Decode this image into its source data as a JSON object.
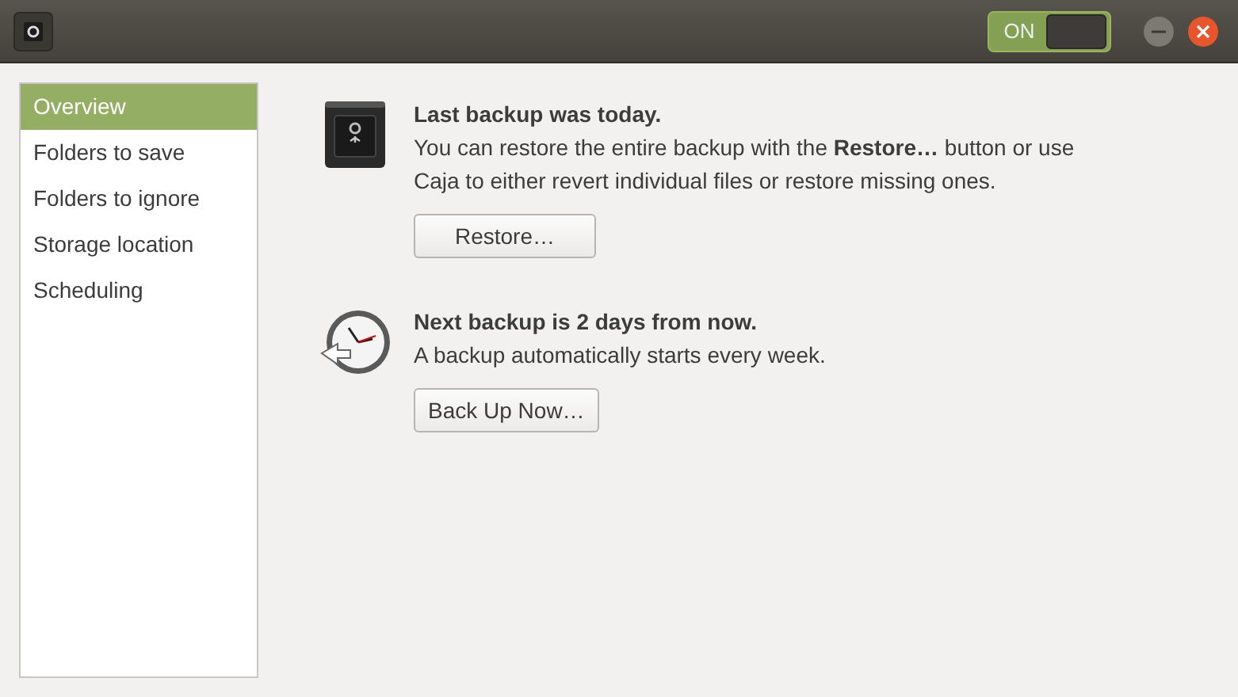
{
  "header": {
    "switch": {
      "label": "ON",
      "on": true
    }
  },
  "sidebar": {
    "items": [
      {
        "label": "Overview",
        "selected": true
      },
      {
        "label": "Folders to save",
        "selected": false
      },
      {
        "label": "Folders to ignore",
        "selected": false
      },
      {
        "label": "Storage location",
        "selected": false
      },
      {
        "label": "Scheduling",
        "selected": false
      }
    ]
  },
  "sections": [
    {
      "kind": "last",
      "title": "Last backup was today.",
      "text": "You can restore the entire backup with the **Restore…** button or use Caja to either revert individual files or restore missing ones.",
      "button": "Restore…"
    },
    {
      "kind": "next",
      "title": "Next backup is 2 days from now.",
      "text": "A backup automatically starts every week.",
      "button": "Back Up Now…"
    }
  ]
}
